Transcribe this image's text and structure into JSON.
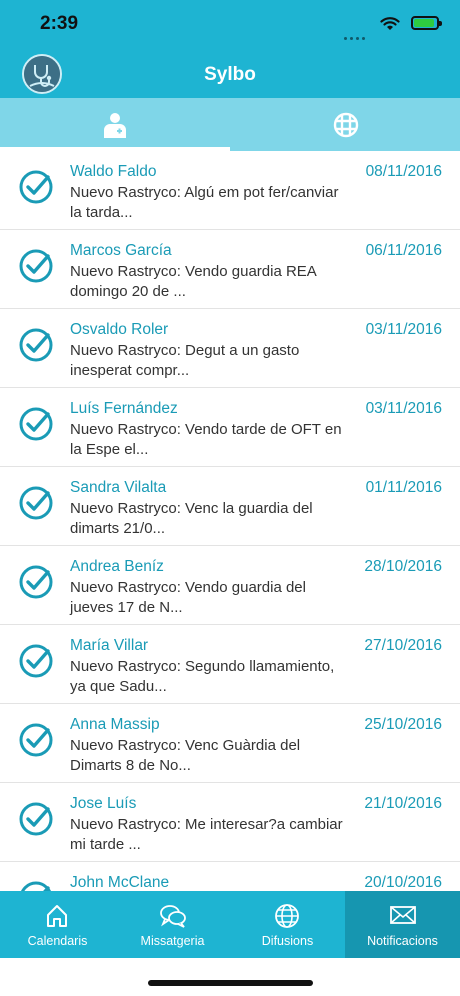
{
  "status": {
    "time": "2:39"
  },
  "header": {
    "title": "Sylbo"
  },
  "tabs": [
    {
      "icon": "doctor-icon",
      "active": true
    },
    {
      "icon": "grid-globe-icon",
      "active": false
    }
  ],
  "notifications": [
    {
      "name": "Waldo Faldo",
      "date": "08/11/2016",
      "line1": "Nuevo Rastryco: Algú em pot fer/canviar",
      "line2": "la tarda..."
    },
    {
      "name": "Marcos García",
      "date": "06/11/2016",
      "line1": "Nuevo Rastryco: Vendo guardia REA",
      "line2": "domingo 20 de ..."
    },
    {
      "name": "Osvaldo Roler",
      "date": "03/11/2016",
      "line1": "Nuevo Rastryco: Degut a un gasto",
      "line2": "inesperat compr..."
    },
    {
      "name": "Luís Fernández",
      "date": "03/11/2016",
      "line1": "Nuevo Rastryco: Vendo tarde de OFT en",
      "line2": "la Espe el..."
    },
    {
      "name": "Sandra Vilalta",
      "date": "01/11/2016",
      "line1": "Nuevo Rastryco: Venc la guardia del",
      "line2": "dimarts 21/0..."
    },
    {
      "name": "Andrea Beníz",
      "date": "28/10/2016",
      "line1": "Nuevo Rastryco: Vendo guardia del",
      "line2": "jueves 17 de N..."
    },
    {
      "name": "María Villar",
      "date": "27/10/2016",
      "line1": "Nuevo Rastryco: Segundo llamamiento,",
      "line2": "ya que Sadu..."
    },
    {
      "name": "Anna Massip",
      "date": "25/10/2016",
      "line1": "Nuevo Rastryco: Venc Guàrdia del",
      "line2": "Dimarts 8 de No..."
    },
    {
      "name": "Jose Luís",
      "date": "21/10/2016",
      "line1": "Nuevo Rastryco: Me interesar?a cambiar",
      "line2": "mi tarde ..."
    },
    {
      "name": "John McClane",
      "date": "20/10/2016",
      "line1": "",
      "line2": ""
    }
  ],
  "tabbar": {
    "items": [
      {
        "label": "Calendaris",
        "icon": "home-icon"
      },
      {
        "label": "Missatgeria",
        "icon": "chat-icon"
      },
      {
        "label": "Difusions",
        "icon": "globe-icon"
      },
      {
        "label": "Notificacions",
        "icon": "envelope-icon"
      }
    ],
    "active_index": 3
  },
  "colors": {
    "primary": "#1eb4d2",
    "tab_strip": "#7fd6e8",
    "accent_text": "#1a9bb6",
    "active_tab": "#1696b0"
  }
}
